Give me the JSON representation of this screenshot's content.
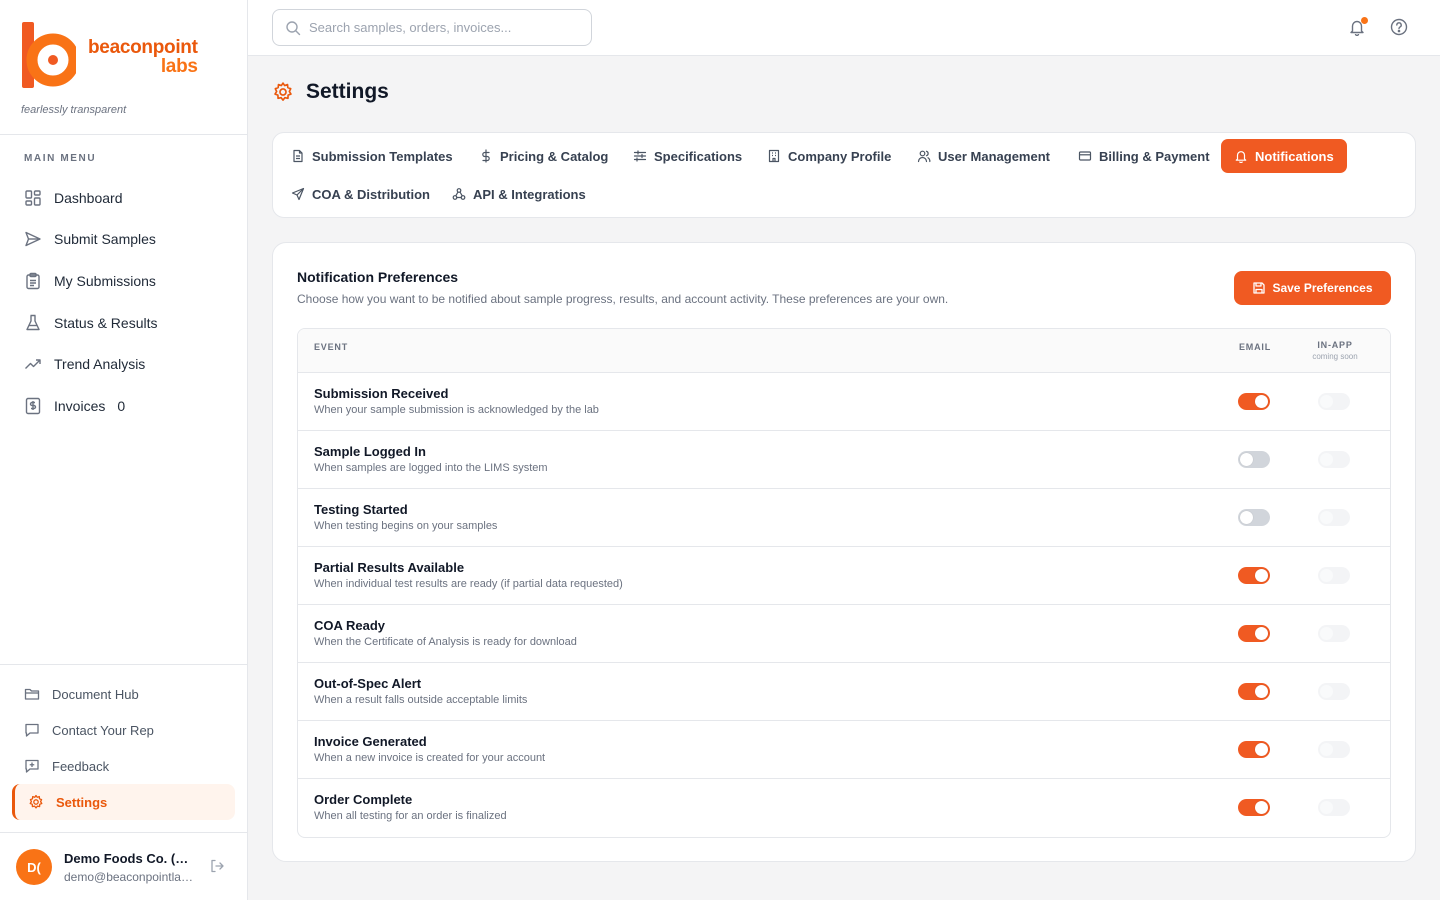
{
  "brand": {
    "name": "beaconpoint",
    "name_sub": "labs",
    "tagline": "fearlessly transparent",
    "colors": {
      "accent": "#f05a22",
      "accent_light": "#f97316"
    }
  },
  "sidebar": {
    "section_label": "MAIN MENU",
    "items": [
      {
        "label": "Dashboard",
        "icon": "dashboard-icon"
      },
      {
        "label": "Submit Samples",
        "icon": "send-icon"
      },
      {
        "label": "My Submissions",
        "icon": "clipboard-icon"
      },
      {
        "label": "Status & Results",
        "icon": "flask-icon"
      },
      {
        "label": "Trend Analysis",
        "icon": "trend-icon"
      },
      {
        "label": "Invoices",
        "icon": "invoice-icon",
        "count": "0"
      }
    ],
    "bottom_items": [
      {
        "label": "Document Hub",
        "icon": "folder-icon"
      },
      {
        "label": "Contact Your Rep",
        "icon": "message-icon"
      },
      {
        "label": "Feedback",
        "icon": "feedback-icon"
      },
      {
        "label": "Settings",
        "icon": "gear-icon",
        "active": true
      }
    ],
    "user": {
      "initials": "D(",
      "name": "Demo Foods Co. (Demo)",
      "email": "demo@beaconpointlabs.com"
    }
  },
  "topbar": {
    "search_placeholder": "Search samples, orders, invoices..."
  },
  "page": {
    "title": "Settings"
  },
  "tabs": [
    {
      "label": "Submission Templates",
      "icon": "file-icon"
    },
    {
      "label": "Pricing & Catalog",
      "icon": "dollar-icon"
    },
    {
      "label": "Specifications",
      "icon": "sliders-icon"
    },
    {
      "label": "Company Profile",
      "icon": "building-icon"
    },
    {
      "label": "User Management",
      "icon": "users-icon"
    },
    {
      "label": "Billing & Payment",
      "icon": "card-icon"
    },
    {
      "label": "Notifications",
      "icon": "bell-icon",
      "active": true
    },
    {
      "label": "COA & Distribution",
      "icon": "paper-plane-icon"
    },
    {
      "label": "API & Integrations",
      "icon": "webhook-icon"
    }
  ],
  "prefs": {
    "title": "Notification Preferences",
    "description": "Choose how you want to be notified about sample progress, results, and account activity. These preferences are your own.",
    "save_label": "Save Preferences",
    "col_event": "EVENT",
    "col_email": "EMAIL",
    "col_inapp": "IN-APP",
    "col_inapp_note": "coming soon",
    "rows": [
      {
        "title": "Submission Received",
        "desc": "When your sample submission is acknowledged by the lab",
        "email": true,
        "inapp": false
      },
      {
        "title": "Sample Logged In",
        "desc": "When samples are logged into the LIMS system",
        "email": false,
        "inapp": false
      },
      {
        "title": "Testing Started",
        "desc": "When testing begins on your samples",
        "email": false,
        "inapp": false
      },
      {
        "title": "Partial Results Available",
        "desc": "When individual test results are ready (if partial data requested)",
        "email": true,
        "inapp": false
      },
      {
        "title": "COA Ready",
        "desc": "When the Certificate of Analysis is ready for download",
        "email": true,
        "inapp": false
      },
      {
        "title": "Out-of-Spec Alert",
        "desc": "When a result falls outside acceptable limits",
        "email": true,
        "inapp": false
      },
      {
        "title": "Invoice Generated",
        "desc": "When a new invoice is created for your account",
        "email": true,
        "inapp": false
      },
      {
        "title": "Order Complete",
        "desc": "When all testing for an order is finalized",
        "email": true,
        "inapp": false
      }
    ]
  }
}
